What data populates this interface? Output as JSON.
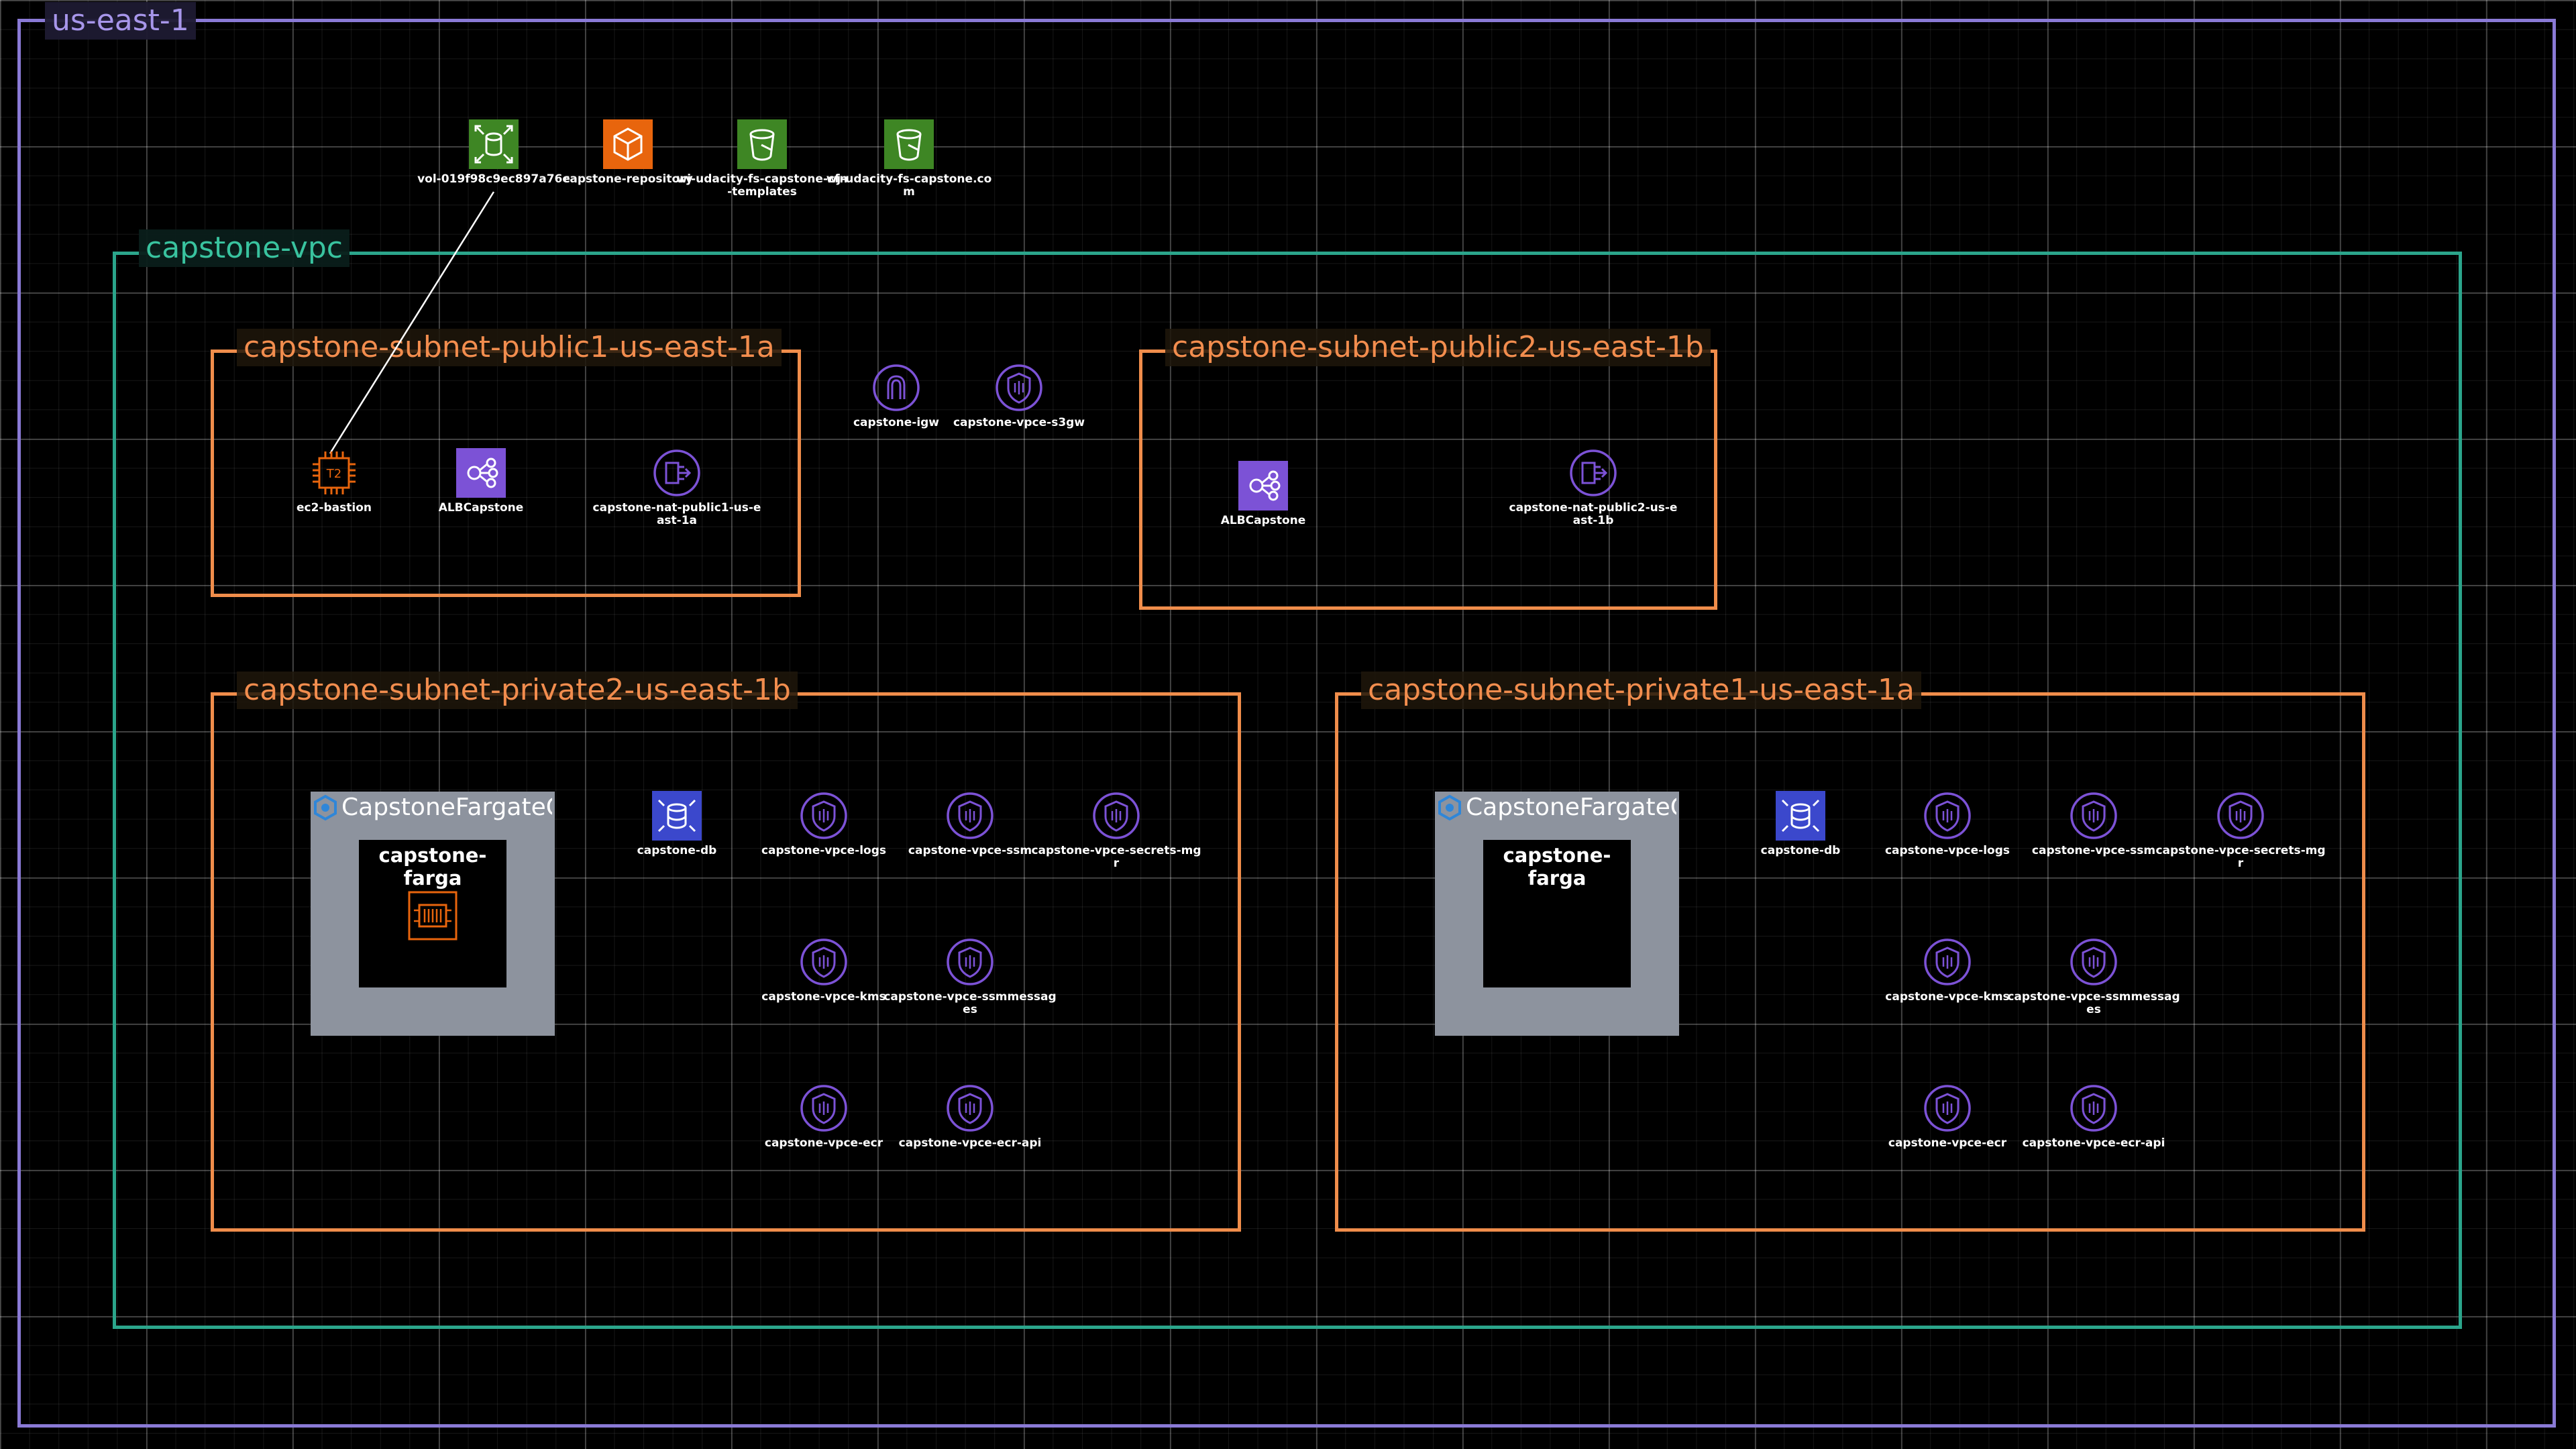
{
  "region": {
    "label": "us-east-1"
  },
  "vpc": {
    "label": "capstone-vpc"
  },
  "top_resources": [
    {
      "label": "vol-019f98c9ec897a76e",
      "type": "ebs-volume",
      "color": "#3e8624"
    },
    {
      "label": "capstone-repository",
      "type": "ecr-repository",
      "color": "#e8650d"
    },
    {
      "label": "wj-udacity-fs-capstone-cfn-templates",
      "type": "s3-bucket",
      "color": "#3e8624"
    },
    {
      "label": "wj-udacity-fs-capstone.com",
      "type": "s3-bucket",
      "color": "#3e8624"
    }
  ],
  "vpc_resources": [
    {
      "label": "capstone-igw",
      "type": "internet-gateway"
    },
    {
      "label": "capstone-vpce-s3gw",
      "type": "vpc-endpoint"
    }
  ],
  "subnets": {
    "public1": {
      "label": "capstone-subnet-public1-us-east-1a",
      "nodes": [
        {
          "label": "ec2-bastion",
          "type": "ec2-instance"
        },
        {
          "label": "ALBCapstone",
          "type": "load-balancer"
        },
        {
          "label": "capstone-nat-public1-us-east-1a",
          "type": "nat-gateway"
        }
      ]
    },
    "public2": {
      "label": "capstone-subnet-public2-us-east-1b",
      "nodes": [
        {
          "label": "ALBCapstone",
          "type": "load-balancer"
        },
        {
          "label": "capstone-nat-public2-us-east-1b",
          "type": "nat-gateway"
        }
      ]
    },
    "private2": {
      "label": "capstone-subnet-private2-us-east-1b",
      "cluster": {
        "label": "CapstoneFargateCluster",
        "task_label": "capstone-farga"
      },
      "nodes": [
        {
          "label": "capstone-db",
          "type": "rds"
        },
        {
          "label": "capstone-vpce-logs",
          "type": "vpc-endpoint"
        },
        {
          "label": "capstone-vpce-ssm",
          "type": "vpc-endpoint"
        },
        {
          "label": "capstone-vpce-secrets-mgr",
          "type": "vpc-endpoint"
        },
        {
          "label": "capstone-vpce-kms",
          "type": "vpc-endpoint"
        },
        {
          "label": "capstone-vpce-ssmmessages",
          "type": "vpc-endpoint"
        },
        {
          "label": "capstone-vpce-ecr",
          "type": "vpc-endpoint"
        },
        {
          "label": "capstone-vpce-ecr-api",
          "type": "vpc-endpoint"
        }
      ]
    },
    "private1": {
      "label": "capstone-subnet-private1-us-east-1a",
      "cluster": {
        "label": "CapstoneFargateCluster",
        "task_label": "capstone-farga"
      },
      "nodes": [
        {
          "label": "capstone-db",
          "type": "rds"
        },
        {
          "label": "capstone-vpce-logs",
          "type": "vpc-endpoint"
        },
        {
          "label": "capstone-vpce-ssm",
          "type": "vpc-endpoint"
        },
        {
          "label": "capstone-vpce-secrets-mgr",
          "type": "vpc-endpoint"
        },
        {
          "label": "capstone-vpce-kms",
          "type": "vpc-endpoint"
        },
        {
          "label": "capstone-vpce-ssmmessages",
          "type": "vpc-endpoint"
        },
        {
          "label": "capstone-vpce-ecr",
          "type": "vpc-endpoint"
        },
        {
          "label": "capstone-vpce-ecr-api",
          "type": "vpc-endpoint"
        }
      ]
    }
  },
  "connections": [
    {
      "from": "ec2-bastion",
      "to": "vol-019f98c9ec897a76e"
    }
  ],
  "colors": {
    "region": "#8a7ad6",
    "vpc": "#2ba58b",
    "subnet": "#f08d4b",
    "network_icon": "#7c52d6",
    "rds": "#3b48cc",
    "ec2": "#e8650d",
    "cluster_bg": "#8d939e"
  }
}
